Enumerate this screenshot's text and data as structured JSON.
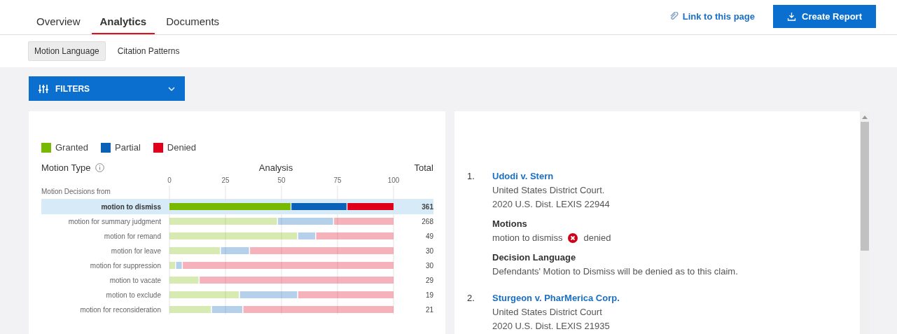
{
  "tabs": [
    {
      "label": "Overview",
      "selected": false
    },
    {
      "label": "Analytics",
      "selected": true
    },
    {
      "label": "Documents",
      "selected": false
    }
  ],
  "link": {
    "label": "Link to this page"
  },
  "create_button": {
    "label": "Create Report"
  },
  "subtabs": [
    {
      "label": "Motion Language",
      "selected": true
    },
    {
      "label": "Citation Patterns",
      "selected": false
    }
  ],
  "filters": {
    "label": "FILTERS"
  },
  "chart_panel": {
    "header": {
      "motion_type": "Motion Type",
      "analysis": "Analysis",
      "total": "Total"
    },
    "group_label": "Motion Decisions from",
    "rows": [
      {
        "total": "361",
        "selected": true
      },
      {
        "total": "268",
        "selected": false
      },
      {
        "total": "49",
        "selected": false
      },
      {
        "total": "30",
        "selected": false
      },
      {
        "total": "30",
        "selected": false
      },
      {
        "total": "29",
        "selected": false
      },
      {
        "total": "19",
        "selected": false
      },
      {
        "total": "21",
        "selected": false
      }
    ],
    "chart_data": {
      "type": "bar",
      "orientation": "horizontal",
      "stacked": true,
      "grid": true,
      "xlim": [
        0,
        100
      ],
      "xticks": [
        0,
        25,
        50,
        75,
        100
      ],
      "categories": [
        "motion to dismiss",
        "motion for summary judgment",
        "motion for remand",
        "motion for leave",
        "motion for suppression",
        "motion to vacate",
        "motion to exclude",
        "motion for reconsideration"
      ],
      "series": [
        {
          "name": "Granted",
          "color": "#76b900",
          "values": [
            54,
            48,
            57,
            22.5,
            2.5,
            13,
            31,
            18.5
          ]
        },
        {
          "name": "Partial",
          "color": "#0a62b8",
          "values": [
            25,
            25,
            8,
            13,
            3,
            0,
            26,
            14
          ]
        },
        {
          "name": "Denied",
          "color": "#e0001b",
          "values": [
            21,
            27,
            35,
            64.5,
            94.5,
            87,
            43,
            67.5
          ]
        }
      ]
    }
  },
  "cases": [
    {
      "number": "1.",
      "title": "Udodi v. Stern",
      "court": "United States District Court.",
      "citation": "2020 U.S. Dist. LEXIS 22944",
      "motions_label": "Motions",
      "motion": "motion to dismiss",
      "kind": "denied",
      "result": "denied",
      "language_label": "Decision Language",
      "language": "Defendants' Motion to Dismiss will be denied as to this claim."
    },
    {
      "number": "2.",
      "title": "Sturgeon v. PharMerica Corp.",
      "court": "United States District Court",
      "citation": "2020 U.S. Dist. LEXIS 21935"
    }
  ]
}
